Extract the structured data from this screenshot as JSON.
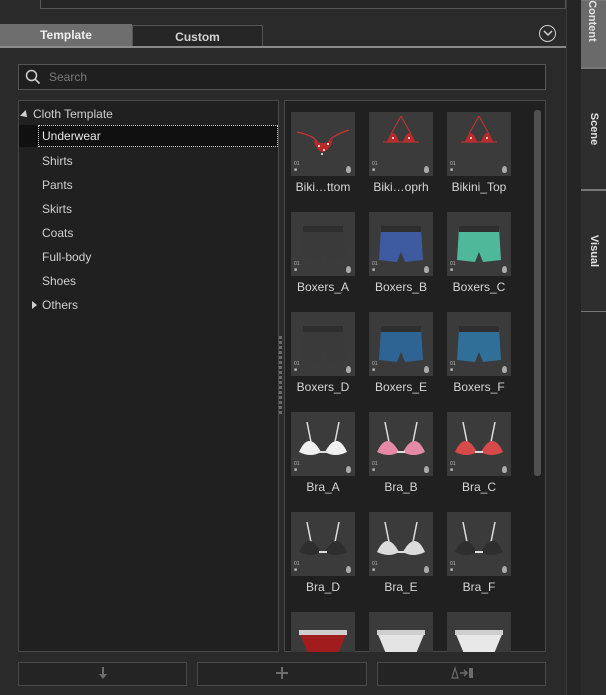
{
  "tabs": {
    "template": "Template",
    "custom": "Custom"
  },
  "search": {
    "placeholder": "Search"
  },
  "tree": {
    "root": "Cloth Template",
    "items": [
      "Underwear",
      "Shirts",
      "Pants",
      "Skirts",
      "Coats",
      "Full-body",
      "Shoes",
      "Others"
    ],
    "selected": "Underwear"
  },
  "grid": {
    "items": [
      {
        "label": "Biki…ttom",
        "icon": "bikini-bottom-thumb"
      },
      {
        "label": "Biki…oprh",
        "icon": "bikini-top-thumb"
      },
      {
        "label": "Bikini_Top",
        "icon": "bikini-top-thumb"
      },
      {
        "label": "Boxers_A",
        "icon": "boxers-thumb"
      },
      {
        "label": "Boxers_B",
        "icon": "boxers-thumb"
      },
      {
        "label": "Boxers_C",
        "icon": "boxers-thumb"
      },
      {
        "label": "Boxers_D",
        "icon": "boxers-thumb"
      },
      {
        "label": "Boxers_E",
        "icon": "boxers-thumb"
      },
      {
        "label": "Boxers_F",
        "icon": "boxers-thumb"
      },
      {
        "label": "Bra_A",
        "icon": "bra-thumb"
      },
      {
        "label": "Bra_B",
        "icon": "bra-thumb"
      },
      {
        "label": "Bra_C",
        "icon": "bra-thumb"
      },
      {
        "label": "Bra_D",
        "icon": "bra-thumb"
      },
      {
        "label": "Bra_E",
        "icon": "bra-thumb"
      },
      {
        "label": "Bra_F",
        "icon": "bra-thumb"
      },
      {
        "label": "",
        "icon": "brief-thumb"
      },
      {
        "label": "",
        "icon": "brief-thumb"
      },
      {
        "label": "",
        "icon": "brief-thumb"
      }
    ]
  },
  "side_tabs": {
    "content": "Content",
    "scene": "Scene",
    "visual": "Visual"
  },
  "bottom_buttons": {
    "download": "download-icon",
    "add": "plus-icon",
    "replace": "replace-icon"
  },
  "colors": {
    "background": "#2a2a2a",
    "panel": "#202020",
    "active_tab": "#6e6e6e"
  }
}
